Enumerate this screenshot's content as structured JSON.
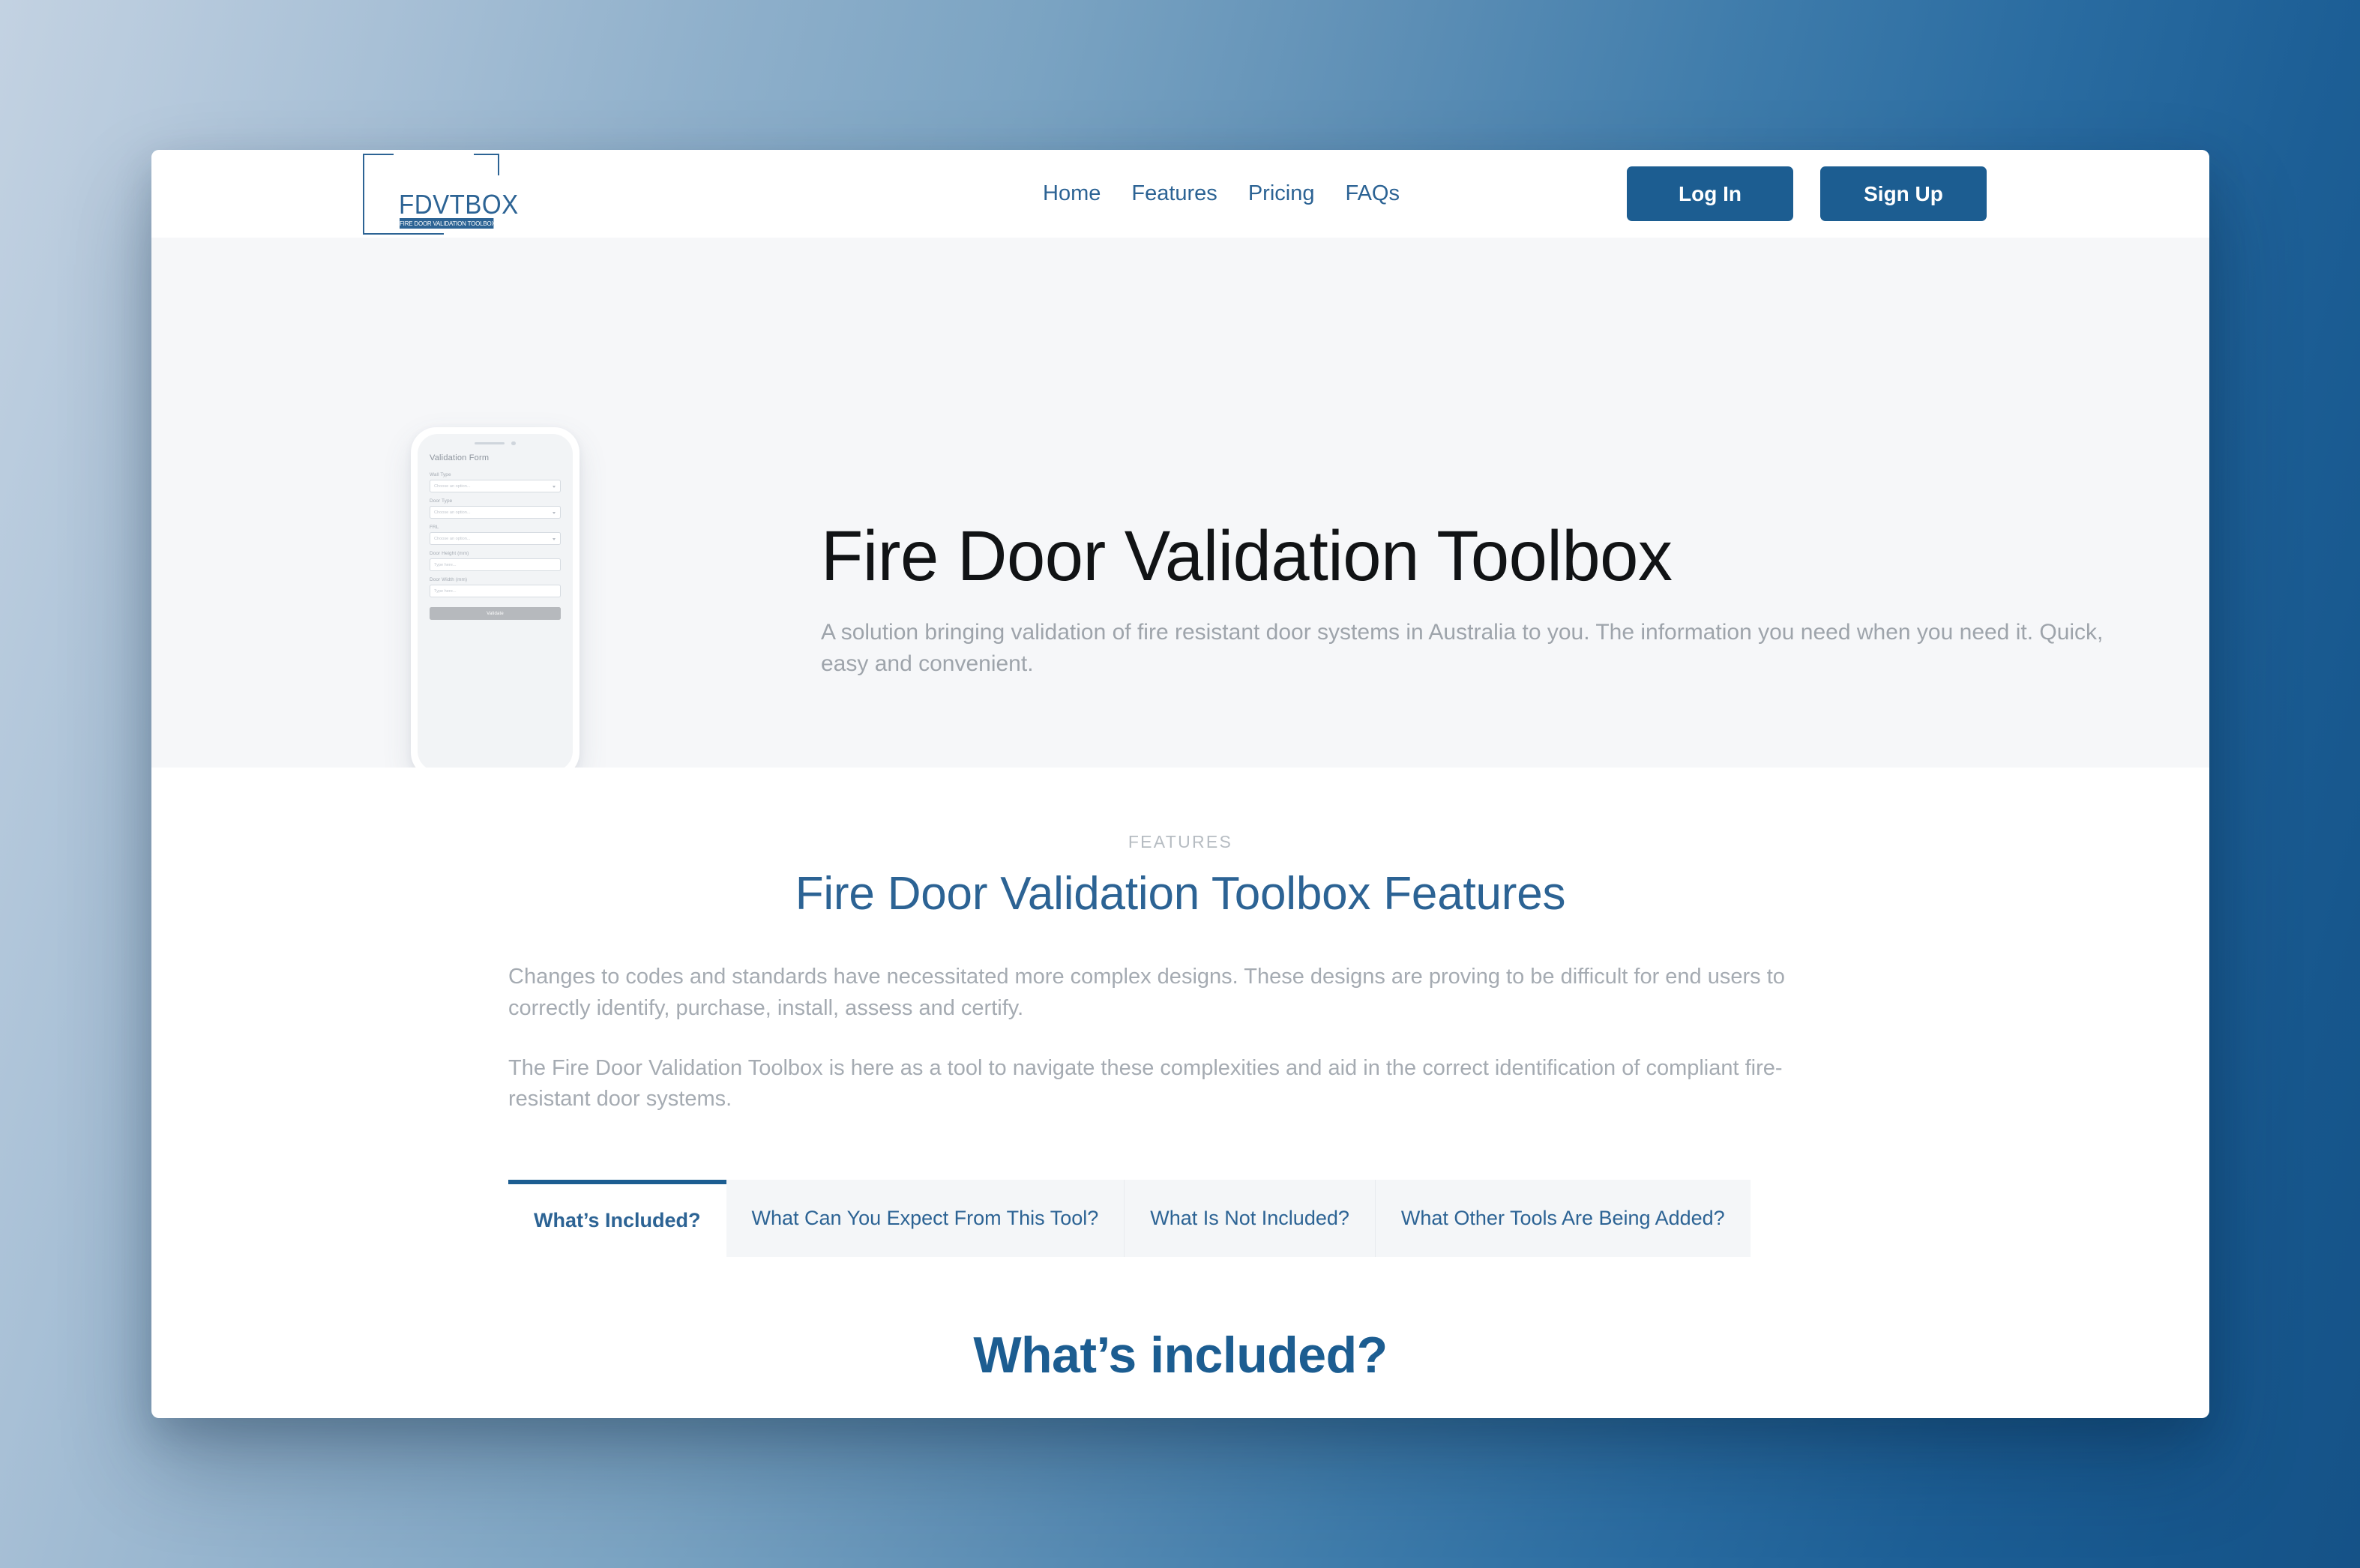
{
  "header": {
    "logo": {
      "wordmark": "FDVTBOX",
      "tagline": "FIRE DOOR VALIDATION TOOLBOX"
    },
    "nav": [
      {
        "label": "Home"
      },
      {
        "label": "Features"
      },
      {
        "label": "Pricing"
      },
      {
        "label": "FAQs"
      }
    ],
    "login_label": "Log In",
    "signup_label": "Sign Up"
  },
  "hero": {
    "title": "Fire Door Validation Toolbox",
    "subtitle": "A solution bringing validation of fire resistant door systems in Australia to you. The information you need when you need it. Quick, easy and convenient.",
    "phone": {
      "form_title": "Validation Form",
      "fields": [
        {
          "label": "Wall Type",
          "placeholder": "Choose an option...",
          "type": "select"
        },
        {
          "label": "Door Type",
          "placeholder": "Choose an option...",
          "type": "select"
        },
        {
          "label": "FRL",
          "placeholder": "Choose an option...",
          "type": "select"
        },
        {
          "label": "Door Height (mm)",
          "placeholder": "Type here...",
          "type": "text"
        },
        {
          "label": "Door Width (mm)",
          "placeholder": "Type here...",
          "type": "text"
        }
      ],
      "submit_label": "Validate"
    }
  },
  "features": {
    "eyebrow": "FEATURES",
    "title": "Fire Door Validation Toolbox Features",
    "paragraphs": [
      "Changes to codes and standards have necessitated more complex designs. These designs are proving to be difficult for end users to correctly identify, purchase, install, assess and certify.",
      "The Fire Door Validation Toolbox is here as a tool to navigate these complexities and aid in the correct identification of compliant fire-resistant door systems."
    ],
    "tabs": [
      {
        "label": "What’s Included?",
        "active": true
      },
      {
        "label": "What Can You Expect From This Tool?",
        "active": false
      },
      {
        "label": "What Is Not Included?",
        "active": false
      },
      {
        "label": "What Other Tools Are Being Added?",
        "active": false
      }
    ],
    "panel_title": "What’s included?"
  },
  "colors": {
    "brand_blue": "#1c5d91",
    "link_blue": "#2c6394",
    "hero_bg": "#f6f7f9",
    "tab_inactive_bg": "#f4f6f8",
    "muted_text": "#a5abb2"
  }
}
